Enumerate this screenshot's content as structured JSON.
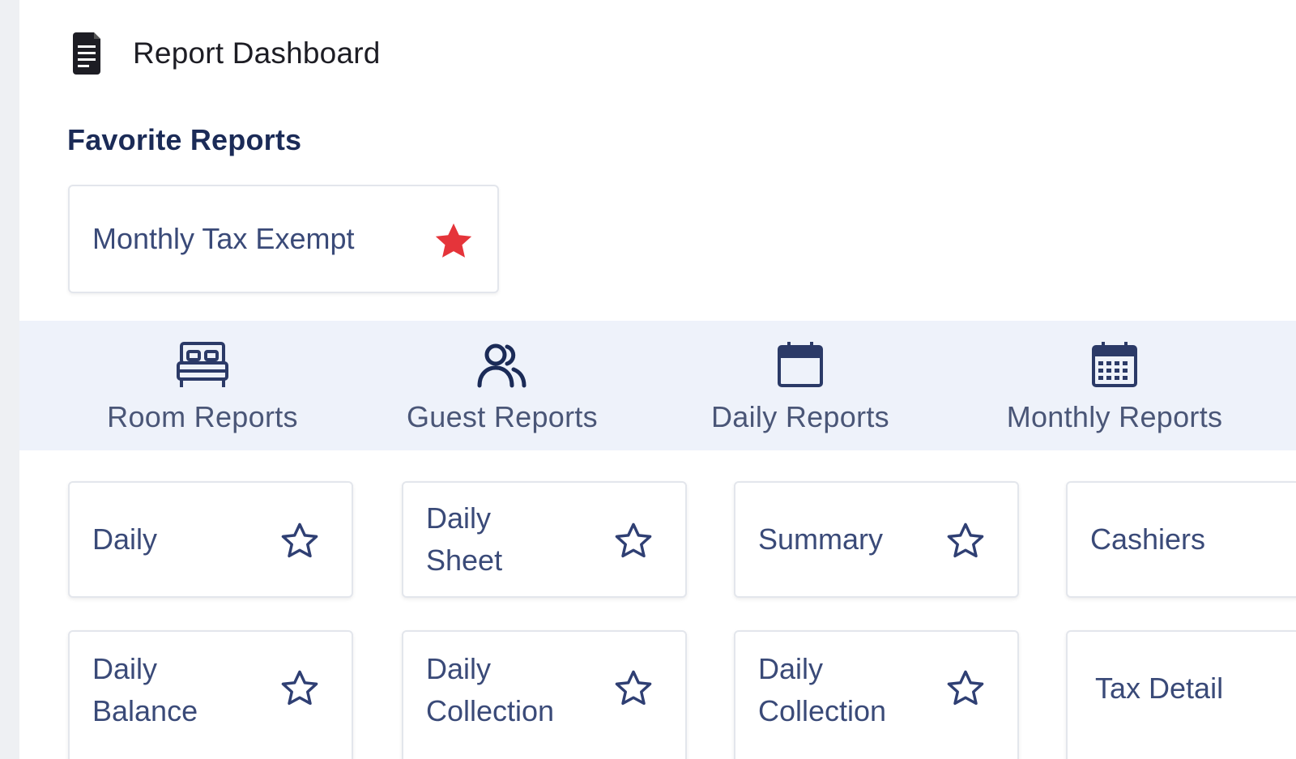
{
  "page": {
    "title": "Report Dashboard",
    "icon": "document-icon"
  },
  "favorites": {
    "heading": "Favorite Reports",
    "items": [
      {
        "label": "Monthly Tax Exempt",
        "starred": true,
        "star_color": "#e5343a"
      }
    ]
  },
  "tabs": [
    {
      "label": "Room Reports",
      "icon": "bed-icon"
    },
    {
      "label": "Guest Reports",
      "icon": "users-icon"
    },
    {
      "label": "Daily Reports",
      "icon": "calendar-icon"
    },
    {
      "label": "Monthly Reports",
      "icon": "calendar-grid-icon"
    }
  ],
  "reports": [
    {
      "label": "Daily",
      "starred": false
    },
    {
      "label": "Daily Sheet",
      "starred": false
    },
    {
      "label": "Summary",
      "starred": false
    },
    {
      "label": "Cashiers",
      "starred": false
    },
    {
      "label": "Daily Balance",
      "starred": false
    },
    {
      "label": "Daily Collection",
      "starred": false
    },
    {
      "label": "Daily Collection",
      "starred": false
    },
    {
      "label": "Tax Detail",
      "starred": false
    }
  ],
  "colors": {
    "accent": "#1b2b57",
    "tab_bar": "#eef2fa",
    "star_active": "#e5343a",
    "star_inactive": "#2f3f73"
  }
}
